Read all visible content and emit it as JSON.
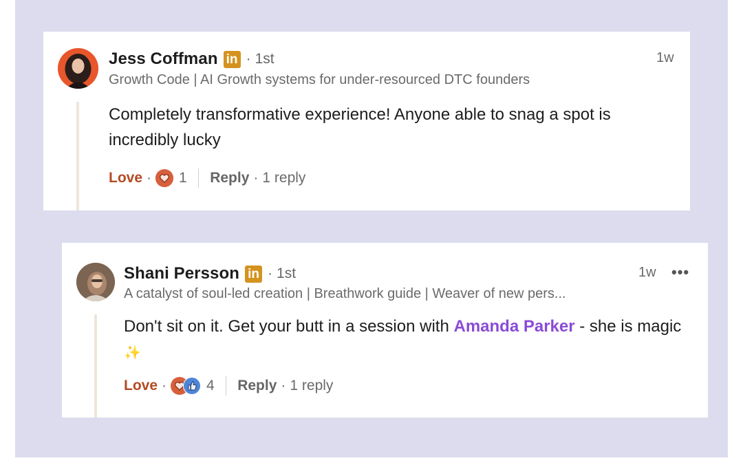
{
  "comments": [
    {
      "author": "Jess Coffman",
      "linkedin_badge": "in",
      "degree": "1st",
      "degree_sep": "·",
      "headline": "Growth Code | AI Growth systems for under-resourced DTC founders",
      "time": "1w",
      "text": "Completely transformative experience! Anyone able to snag a spot is incredibly lucky",
      "love_label": "Love",
      "dot": "·",
      "reaction_count": "1",
      "reply_label": "Reply",
      "replies": "1 reply",
      "reaction_icons": [
        "heart-reaction"
      ]
    },
    {
      "author": "Shani Persson",
      "linkedin_badge": "in",
      "degree": "1st",
      "degree_sep": "·",
      "headline": "A catalyst of soul-led creation | Breathwork guide | Weaver of new pers...",
      "time": "1w",
      "more": "•••",
      "text_before": "Don't sit on it. Get your butt in a session with ",
      "mention": "Amanda Parker",
      "text_after": " - she is magic ",
      "sparkle": "✨",
      "love_label": "Love",
      "dot": "·",
      "reaction_count": "4",
      "reply_label": "Reply",
      "replies": "1 reply",
      "reaction_icons": [
        "heart-reaction",
        "like-reaction"
      ]
    }
  ],
  "colors": {
    "background": "#dcdcee",
    "love": "#b54a25",
    "mention": "#8a4bd6",
    "linkedin_badge": "#d4921f"
  }
}
